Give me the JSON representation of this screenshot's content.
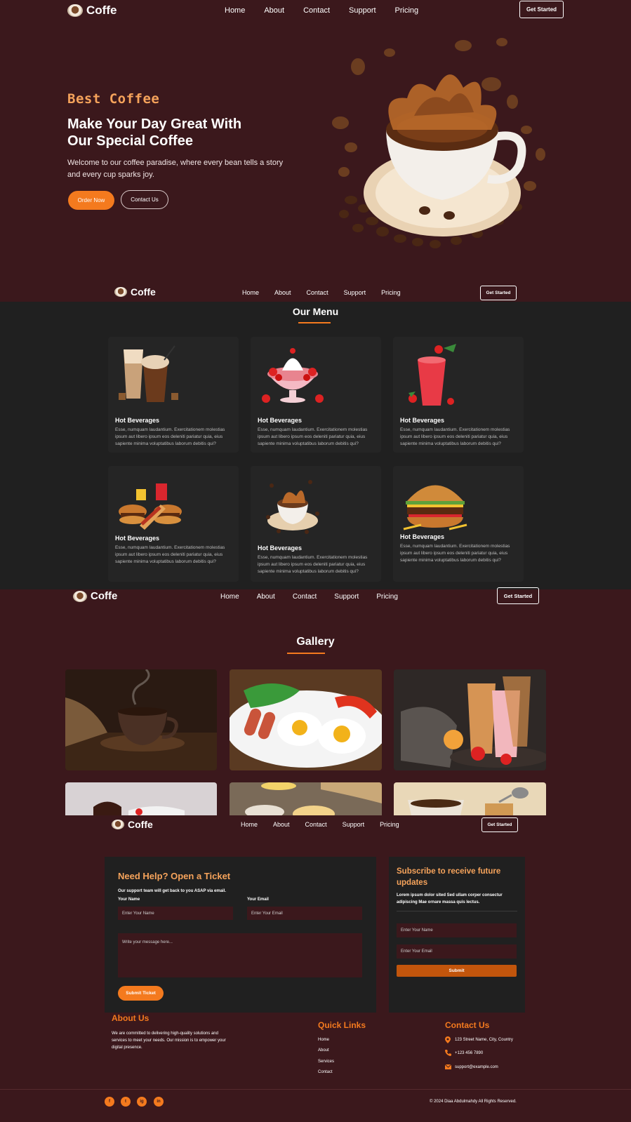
{
  "brand": "Coffe",
  "nav": {
    "links": [
      "Home",
      "About",
      "Contact",
      "Support",
      "Pricing"
    ],
    "cta": "Get Started"
  },
  "hero": {
    "subtitle": "Best Coffee",
    "title_line1": "Make Your Day Great With",
    "title_line2": "Our Special Coffee",
    "text_line1": "Welcome to our coffee paradise, where every bean tells a story",
    "text_line2": "and every cup sparks joy.",
    "primary_button": "Order Now",
    "secondary_button": "Contact Us"
  },
  "menu": {
    "title": "Our Menu",
    "items": [
      {
        "title": "Hot Beverages",
        "text": "Esse, numquam laudantium. Exercitationem molestias ipsum aut libero ipsum eos deleniti pariatur quia, eius sapiente minima voluptatibus laborum debitis qui?"
      },
      {
        "title": "Hot Beverages",
        "text": "Esse, numquam laudantium. Exercitationem molestias ipsum aut libero ipsum eos deleniti pariatur quia, eius sapiente minima voluptatibus laborum debitis qui?"
      },
      {
        "title": "Hot Beverages",
        "text": "Esse, numquam laudantium. Exercitationem molestias ipsum aut libero ipsum eos deleniti pariatur quia, eius sapiente minima voluptatibus laborum debitis qui?"
      },
      {
        "title": "Hot Beverages",
        "text": "Esse, numquam laudantium. Exercitationem molestias ipsum aut libero ipsum eos deleniti pariatur quia, eius sapiente minima voluptatibus laborum debitis qui?"
      },
      {
        "title": "Hot Beverages",
        "text": "Esse, numquam laudantium. Exercitationem molestias ipsum aut libero ipsum eos deleniti pariatur quia, eius sapiente minima voluptatibus laborum debitis qui?"
      },
      {
        "title": "Hot Beverages",
        "text": "Esse, numquam laudantium. Exercitationem molestias ipsum aut libero ipsum eos deleniti pariatur quia, eius sapiente minima voluptatibus laborum debitis qui?"
      }
    ]
  },
  "gallery": {
    "title": "Gallery"
  },
  "ticket": {
    "title": "Need Help? Open a Ticket",
    "subtitle": "Our support team will get back to you ASAP via email.",
    "name_label": "Your Name",
    "name_placeholder": "Enter Your Name",
    "email_label": "Your Email",
    "email_placeholder": "Enter Your Email",
    "message_placeholder": "Write your message here...",
    "submit": "Submit Ticket"
  },
  "subscribe": {
    "title_line1": "Subscribe to receive future",
    "title_line2": "updates",
    "text_line1": "Lorem ipsum dolor sited Sed ullam corper consectur",
    "text_line2": "adipiscing Mae ornare massa quis lectus.",
    "name_placeholder": "Enter Your Name",
    "email_placeholder": "Enter Your Email",
    "submit": "Submit"
  },
  "footer": {
    "about_title": "About Us",
    "about_line1": "We are committed to delivering high-quality solutions and",
    "about_line2": "services to meet your needs. Our mission is to empower your",
    "about_line3": "digital presence.",
    "links_title": "Quick Links",
    "links": [
      "Home",
      "About",
      "Services",
      "Contact"
    ],
    "contact_title": "Contact Us",
    "address": "123 Street Name, City, Country",
    "phone": "+123 456 7890",
    "email": "support@example.com",
    "social": [
      "f",
      "t",
      "ig",
      "in"
    ],
    "copyright": "© 2024 Diaa Abdulmahdy All Rights Reserved."
  },
  "colors": {
    "background": "#3b181c",
    "menu_background": "#202020",
    "accent": "#f47a1e",
    "heading_accent": "#f6a35b"
  }
}
